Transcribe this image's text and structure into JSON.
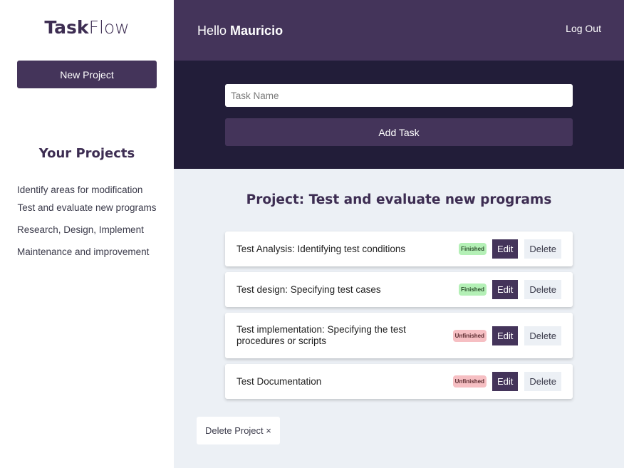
{
  "app": {
    "logo_bold": "Task",
    "logo_light": "Flow"
  },
  "sidebar": {
    "new_project_label": "New Project",
    "projects_title": "Your Projects",
    "projects": [
      "Identify areas for modification",
      "Test and evaluate new programs",
      "Research, Design, Implement",
      "Maintenance and improvement"
    ]
  },
  "header": {
    "greeting": "Hello",
    "user_name": "Mauricio",
    "logout_label": "Log Out"
  },
  "task_form": {
    "placeholder": "Task Name",
    "add_label": "Add Task"
  },
  "main": {
    "project_title": "Project: Test and evaluate new programs",
    "edit_label": "Edit",
    "delete_label": "Delete",
    "tasks": [
      {
        "name": "Test Analysis: Identifying test conditions",
        "status": "Finished"
      },
      {
        "name": "Test design: Specifying test cases",
        "status": "Finished"
      },
      {
        "name": "Test implementation: Specifying the test procedures or scripts",
        "status": "Unfinished"
      },
      {
        "name": "Test Documentation",
        "status": "Unfinished"
      }
    ],
    "delete_project_label": "Delete Project ×"
  },
  "colors": {
    "primary": "#44345a",
    "dark": "#221d39",
    "background": "#ecf0f5",
    "finished": "#b4f0b6",
    "unfinished": "#f6bfc3"
  }
}
